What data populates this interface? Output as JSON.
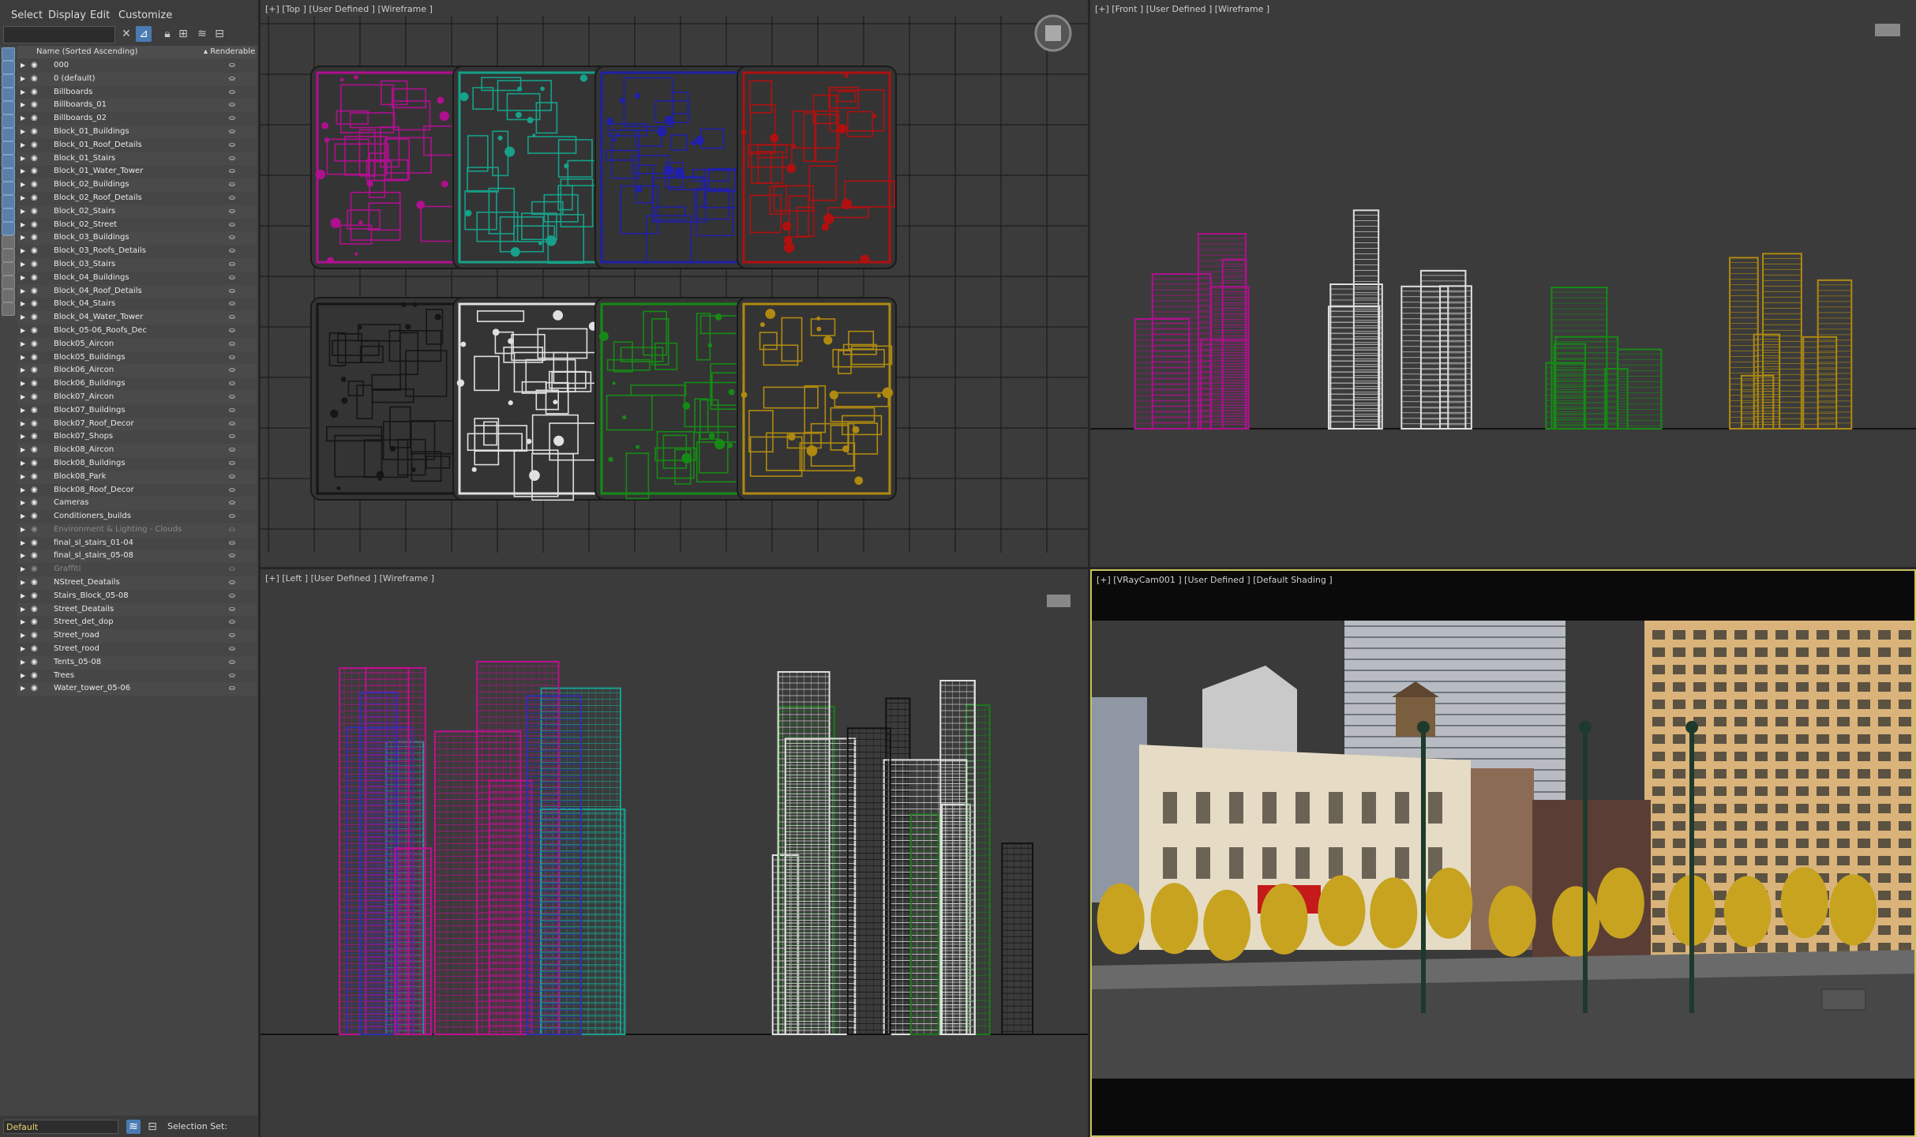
{
  "menu": [
    "Select",
    "Display",
    "Edit",
    "Customize"
  ],
  "explorer": {
    "col_name": "Name (Sorted Ascending)",
    "col_renderable": "▴ Renderable",
    "layers": [
      {
        "name": "000"
      },
      {
        "name": "0 (default)"
      },
      {
        "name": "Billboards"
      },
      {
        "name": "Billboards_01"
      },
      {
        "name": "Billboards_02"
      },
      {
        "name": "Block_01_Buildings"
      },
      {
        "name": "Block_01_Roof_Details"
      },
      {
        "name": "Block_01_Stairs"
      },
      {
        "name": "Block_01_Water_Tower"
      },
      {
        "name": "Block_02_Buildings"
      },
      {
        "name": "Block_02_Roof_Details"
      },
      {
        "name": "Block_02_Stairs"
      },
      {
        "name": "Block_02_Street"
      },
      {
        "name": "Block_03_Buildings"
      },
      {
        "name": "Block_03_Roofs_Details"
      },
      {
        "name": "Block_03_Stairs"
      },
      {
        "name": "Block_04_Buildings"
      },
      {
        "name": "Block_04_Roof_Details"
      },
      {
        "name": "Block_04_Stairs"
      },
      {
        "name": "Block_04_Water_Tower"
      },
      {
        "name": "Block_05-06_Roofs_Dec"
      },
      {
        "name": "Block05_Aircon"
      },
      {
        "name": "Block05_Buildings"
      },
      {
        "name": "Block06_Aircon"
      },
      {
        "name": "Block06_Buildings"
      },
      {
        "name": "Block07_Aircon"
      },
      {
        "name": "Block07_Buildings"
      },
      {
        "name": "Block07_Roof_Decor"
      },
      {
        "name": "Block07_Shops"
      },
      {
        "name": "Block08_Aircon"
      },
      {
        "name": "Block08_Buildings"
      },
      {
        "name": "Block08_Park"
      },
      {
        "name": "Block08_Roof_Decor"
      },
      {
        "name": "Cameras"
      },
      {
        "name": "Conditioners_builds"
      },
      {
        "name": "Environment & Lighting - Clouds",
        "dim": true
      },
      {
        "name": "final_sl_stairs_01-04"
      },
      {
        "name": "final_sl_stairs_05-08"
      },
      {
        "name": "Graffiti",
        "dim": true
      },
      {
        "name": "NStreet_Deatails"
      },
      {
        "name": "Stairs_Block_05-08"
      },
      {
        "name": "Street_Deatails"
      },
      {
        "name": "Street_det_dop"
      },
      {
        "name": "Street_road"
      },
      {
        "name": "Street_rood"
      },
      {
        "name": "Tents_05-08"
      },
      {
        "name": "Trees"
      },
      {
        "name": "Water_tower_05-06"
      }
    ]
  },
  "status": {
    "layer": "Default",
    "selection_set": "Selection Set:"
  },
  "viewports": {
    "top": "[+] [Top ] [User Defined ] [Wireframe ]",
    "front": "[+] [Front ] [User Defined ] [Wireframe ]",
    "left": "[+] [Left ] [User Defined ] [Wireframe ]",
    "persp": "[+] [VRayCam001 ] [User Defined ] [Default Shading ]"
  },
  "colors": {
    "magenta": "#b0108f",
    "teal": "#17a08a",
    "blue": "#2020a8",
    "red": "#b01010",
    "black": "#151515",
    "white": "#e0e0e0",
    "green": "#168a16",
    "gold": "#b08a10",
    "accent": "#4a7bb2",
    "active_border": "#c7c35a"
  },
  "icons": {
    "search_clear": "close-icon",
    "filter": "filter-icon",
    "lock": "lock-icon",
    "hierarchy": "hierarchy-icon",
    "layers": "layers-icon",
    "viewcube": "viewcube-icon"
  }
}
